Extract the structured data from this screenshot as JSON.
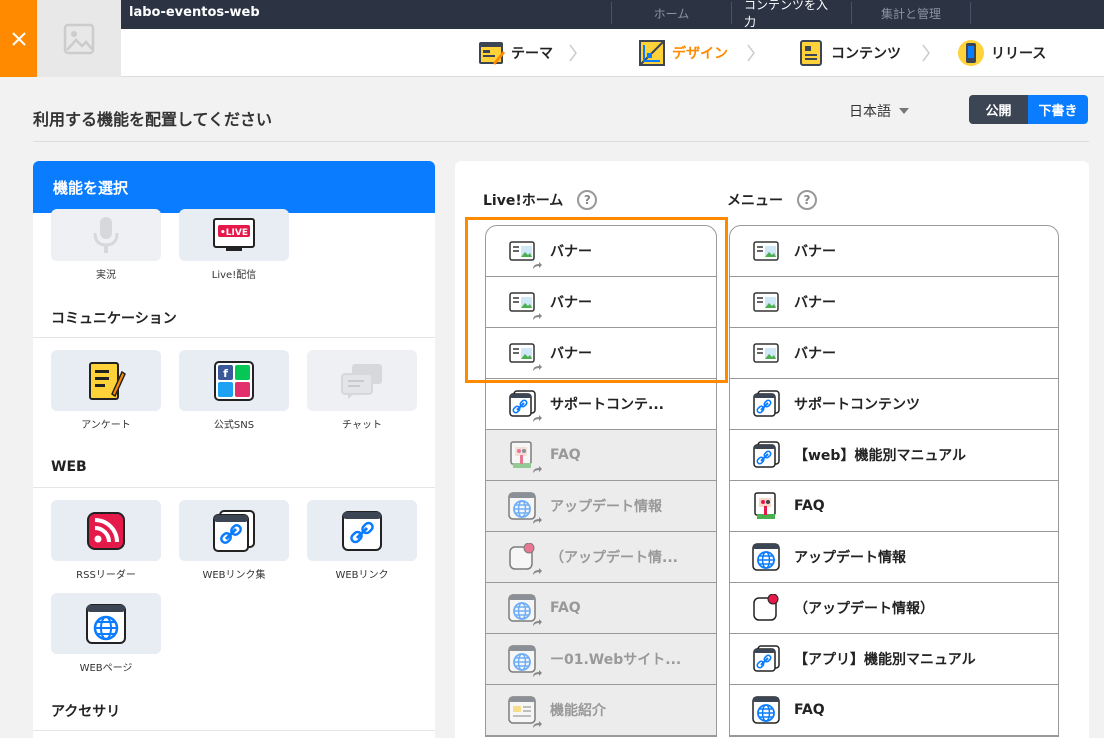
{
  "header": {
    "app_title": "labo-eventos-web",
    "top_nav": [
      "ホーム",
      "コンテンツを入力",
      "集計と管理"
    ],
    "top_nav_active": 1,
    "steps": [
      "テーマ",
      "デザイン",
      "コンテンツ",
      "リリース"
    ],
    "active_step": 1,
    "accent": "#ff8a00"
  },
  "page": {
    "title": "利用する機能を配置してください",
    "language": "日本語",
    "publish_label": "公開",
    "draft_label": "下書き"
  },
  "palette": {
    "title": "機能を選択",
    "top_items": [
      {
        "label": "実況",
        "icon": "microphone-icon",
        "disabled": true
      },
      {
        "label": "Live!配信",
        "icon": "live-tv-icon",
        "disabled": false
      }
    ],
    "sections": [
      {
        "title": "コミュニケーション",
        "items": [
          {
            "label": "アンケート",
            "icon": "survey-icon",
            "disabled": false
          },
          {
            "label": "公式SNS",
            "icon": "sns-icon",
            "disabled": false
          },
          {
            "label": "チャット",
            "icon": "chat-icon",
            "disabled": true
          }
        ]
      },
      {
        "title": "WEB",
        "items": [
          {
            "label": "RSSリーダー",
            "icon": "rss-icon",
            "disabled": false
          },
          {
            "label": "WEBリンク集",
            "icon": "link-collection-icon",
            "disabled": false
          },
          {
            "label": "WEBリンク",
            "icon": "web-link-icon",
            "disabled": false
          },
          {
            "label": "WEBページ",
            "icon": "web-page-icon",
            "disabled": false
          }
        ]
      },
      {
        "title": "アクセサリ",
        "items": []
      }
    ]
  },
  "editor": {
    "live_home": {
      "title": "Live!ホーム",
      "rows": [
        {
          "label": "バナー",
          "icon": "banner-icon",
          "disabled": false
        },
        {
          "label": "バナー",
          "icon": "banner-icon",
          "disabled": false
        },
        {
          "label": "バナー",
          "icon": "banner-icon",
          "disabled": false
        },
        {
          "label": "サポートコンテ...",
          "icon": "link-icon",
          "disabled": false
        },
        {
          "label": "FAQ",
          "icon": "faq-icon",
          "disabled": true
        },
        {
          "label": "アップデート情報",
          "icon": "globe-icon",
          "disabled": true
        },
        {
          "label": "（アップデート情...",
          "icon": "notice-icon",
          "disabled": true
        },
        {
          "label": "FAQ",
          "icon": "globe-icon",
          "disabled": true
        },
        {
          "label": "ー01.Webサイト...",
          "icon": "globe-icon",
          "disabled": true
        },
        {
          "label": "機能紹介",
          "icon": "page-icon",
          "disabled": true
        }
      ]
    },
    "menu": {
      "title": "メニュー",
      "rows": [
        {
          "label": "バナー",
          "icon": "banner-icon"
        },
        {
          "label": "バナー",
          "icon": "banner-icon"
        },
        {
          "label": "バナー",
          "icon": "banner-icon"
        },
        {
          "label": "サポートコンテンツ",
          "icon": "link-icon"
        },
        {
          "label": "【web】機能別マニュアル",
          "icon": "link-icon"
        },
        {
          "label": "FAQ",
          "icon": "faq-icon"
        },
        {
          "label": "アップデート情報",
          "icon": "globe-icon"
        },
        {
          "label": "（アップデート情報）",
          "icon": "notice-icon"
        },
        {
          "label": "【アプリ】機能別マニュアル",
          "icon": "link-icon"
        },
        {
          "label": "FAQ",
          "icon": "globe-icon"
        }
      ]
    }
  }
}
